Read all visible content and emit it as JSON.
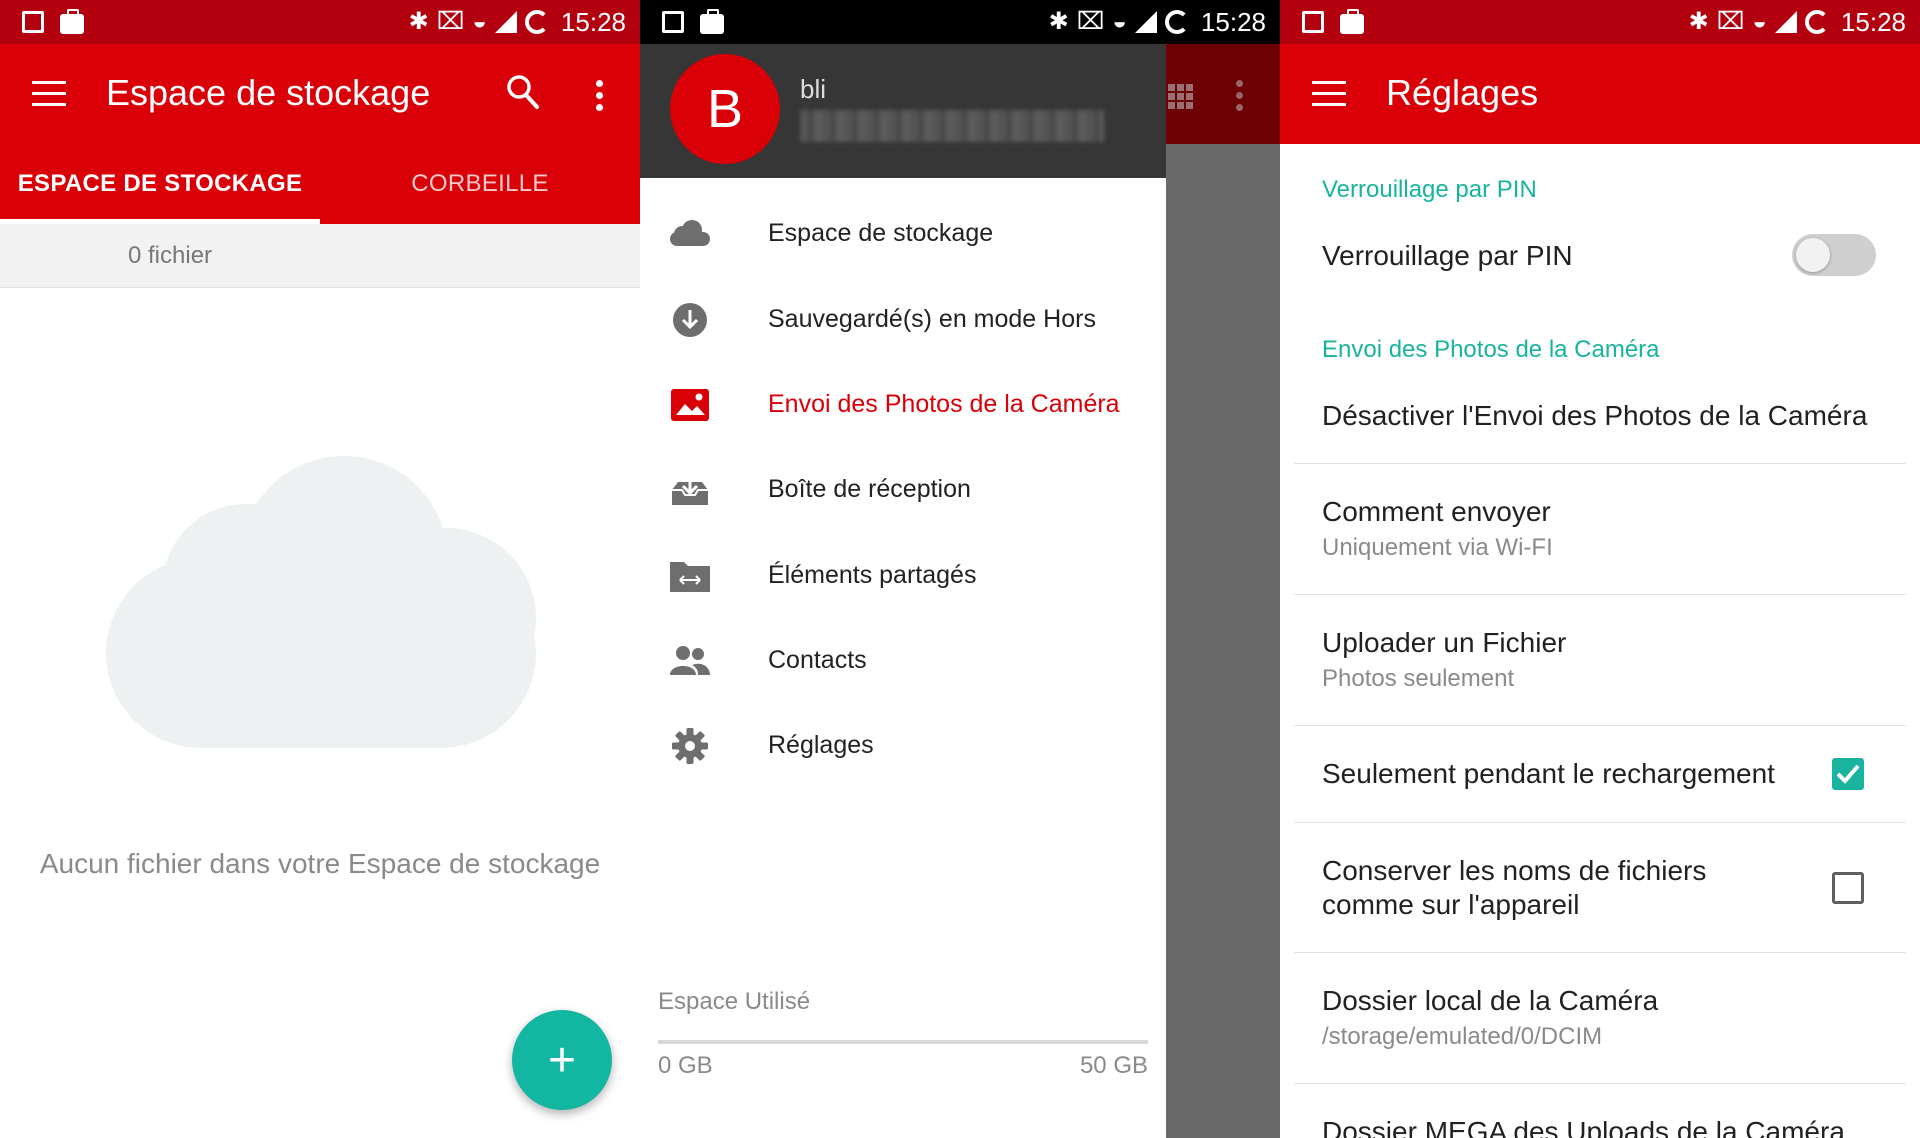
{
  "status_bar": {
    "time": "15:28"
  },
  "storage_screen": {
    "title": "Espace de stockage",
    "tabs": [
      {
        "label": "ESPACE DE STOCKAGE",
        "active": true
      },
      {
        "label": "CORBEILLE",
        "active": false
      }
    ],
    "file_count": "0 fichier",
    "empty_message": "Aucun fichier dans votre Espace de stockage",
    "fab_label": "+"
  },
  "drawer": {
    "avatar_letter": "B",
    "user_name": "bli",
    "items": [
      {
        "label": "Espace de stockage",
        "icon": "cloud-icon"
      },
      {
        "label": "Sauvegardé(s) en mode Hors",
        "icon": "download-icon"
      },
      {
        "label": "Envoi des Photos de la Caméra",
        "icon": "camera-upload-icon",
        "active": true
      },
      {
        "label": "Boîte de réception",
        "icon": "inbox-icon"
      },
      {
        "label": "Éléments partagés",
        "icon": "shared-folder-icon"
      },
      {
        "label": "Contacts",
        "icon": "contacts-icon"
      },
      {
        "label": "Réglages",
        "icon": "gear-icon"
      }
    ],
    "storage": {
      "label": "Espace Utilisé",
      "min": "0 GB",
      "max": "50 GB",
      "used_fraction": 0
    }
  },
  "settings_screen": {
    "title": "Réglages",
    "pin_section": "Verrouillage par PIN",
    "pin_toggle": {
      "label": "Verrouillage par PIN",
      "on": false
    },
    "camera_section": "Envoi des Photos de la Caméra",
    "items": [
      {
        "title": "Désactiver l'Envoi des Photos de la Caméra"
      },
      {
        "title": "Comment envoyer",
        "subtitle": "Uniquement via Wi-FI"
      },
      {
        "title": "Uploader un Fichier",
        "subtitle": "Photos seulement"
      },
      {
        "title": "Seulement pendant le rechargement",
        "checked": true
      },
      {
        "title": "Conserver les noms de fichiers",
        "title2": "comme sur l'appareil",
        "checked": false
      },
      {
        "title": "Dossier local de la Caméra",
        "subtitle": "/storage/emulated/0/DCIM"
      },
      {
        "title": "Dossier MEGA des Uploads de la Caméra"
      }
    ]
  },
  "colors": {
    "brand_red": "#d90007",
    "accent_teal": "#19b39e",
    "status_bar_red": "#b3000f"
  }
}
